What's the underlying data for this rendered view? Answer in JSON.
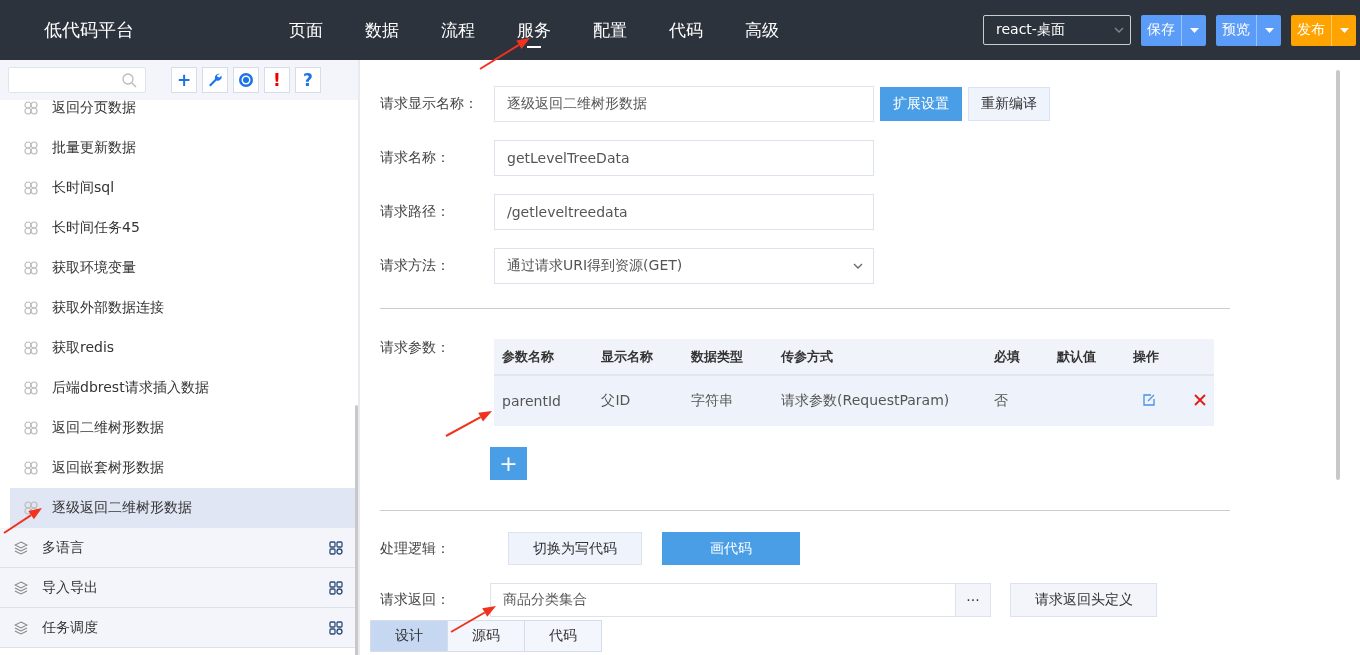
{
  "app": {
    "title": "低代码平台"
  },
  "nav": [
    {
      "label": "页面",
      "selected": false
    },
    {
      "label": "数据",
      "selected": false
    },
    {
      "label": "流程",
      "selected": false
    },
    {
      "label": "服务",
      "selected": true
    },
    {
      "label": "配置",
      "selected": false
    },
    {
      "label": "代码",
      "selected": false
    },
    {
      "label": "高级",
      "selected": false
    }
  ],
  "env_select": {
    "value": "react-桌面"
  },
  "actions": [
    {
      "label": "保存",
      "kind": "primary"
    },
    {
      "label": "预览",
      "kind": "primary"
    },
    {
      "label": "发布",
      "kind": "warning"
    }
  ],
  "sidebar": {
    "tools": [
      {
        "kind": "add",
        "text": "+"
      },
      {
        "kind": "wrench"
      },
      {
        "kind": "target"
      },
      {
        "kind": "alert",
        "text": "!"
      },
      {
        "kind": "help",
        "text": "?"
      }
    ],
    "items": [
      {
        "label": "返回分页数据",
        "selected": false
      },
      {
        "label": "批量更新数据",
        "selected": false
      },
      {
        "label": "长时间sql",
        "selected": false
      },
      {
        "label": "长时间任务45",
        "selected": false
      },
      {
        "label": "获取环境变量",
        "selected": false
      },
      {
        "label": "获取外部数据连接",
        "selected": false
      },
      {
        "label": "获取redis",
        "selected": false
      },
      {
        "label": "后端dbrest请求插入数据",
        "selected": false
      },
      {
        "label": "返回二维树形数据",
        "selected": false
      },
      {
        "label": "返回嵌套树形数据",
        "selected": false
      },
      {
        "label": "逐级返回二维树形数据",
        "selected": true
      }
    ],
    "groups": [
      {
        "label": "多语言"
      },
      {
        "label": "导入导出"
      },
      {
        "label": "任务调度"
      }
    ]
  },
  "form": {
    "fields": [
      {
        "label": "请求显示名称：",
        "value": "逐级返回二维树形数据",
        "kind": "input"
      },
      {
        "label": "请求名称：",
        "value": "getLevelTreeData",
        "kind": "input"
      },
      {
        "label": "请求路径：",
        "value": "/getleveltreedata",
        "kind": "input"
      },
      {
        "label": "请求方法：",
        "value": "通过请求URI得到资源(GET)",
        "kind": "select"
      }
    ],
    "field_buttons": [
      {
        "label": "扩展设置",
        "kind": "primary"
      },
      {
        "label": "重新编译",
        "kind": "default"
      }
    ],
    "params": {
      "label": "请求参数：",
      "columns": [
        "参数名称",
        "显示名称",
        "数据类型",
        "传参方式",
        "必填",
        "默认值",
        "操作"
      ],
      "rows": [
        {
          "cells": [
            "parentId",
            "父ID",
            "字符串",
            "请求参数(RequestParam)",
            "否"
          ]
        }
      ],
      "add": "+"
    },
    "logic": {
      "label": "处理逻辑：",
      "buttons": [
        {
          "label": "切换为写代码",
          "selected": false
        },
        {
          "label": "画代码",
          "selected": true
        }
      ]
    },
    "response": {
      "label": "请求返回：",
      "value": "商品分类集合",
      "more": "···",
      "header_button": "请求返回头定义"
    }
  },
  "bottom_tabs": [
    {
      "label": "设计",
      "selected": true
    },
    {
      "label": "源码",
      "selected": false
    },
    {
      "label": "代码",
      "selected": false
    }
  ]
}
